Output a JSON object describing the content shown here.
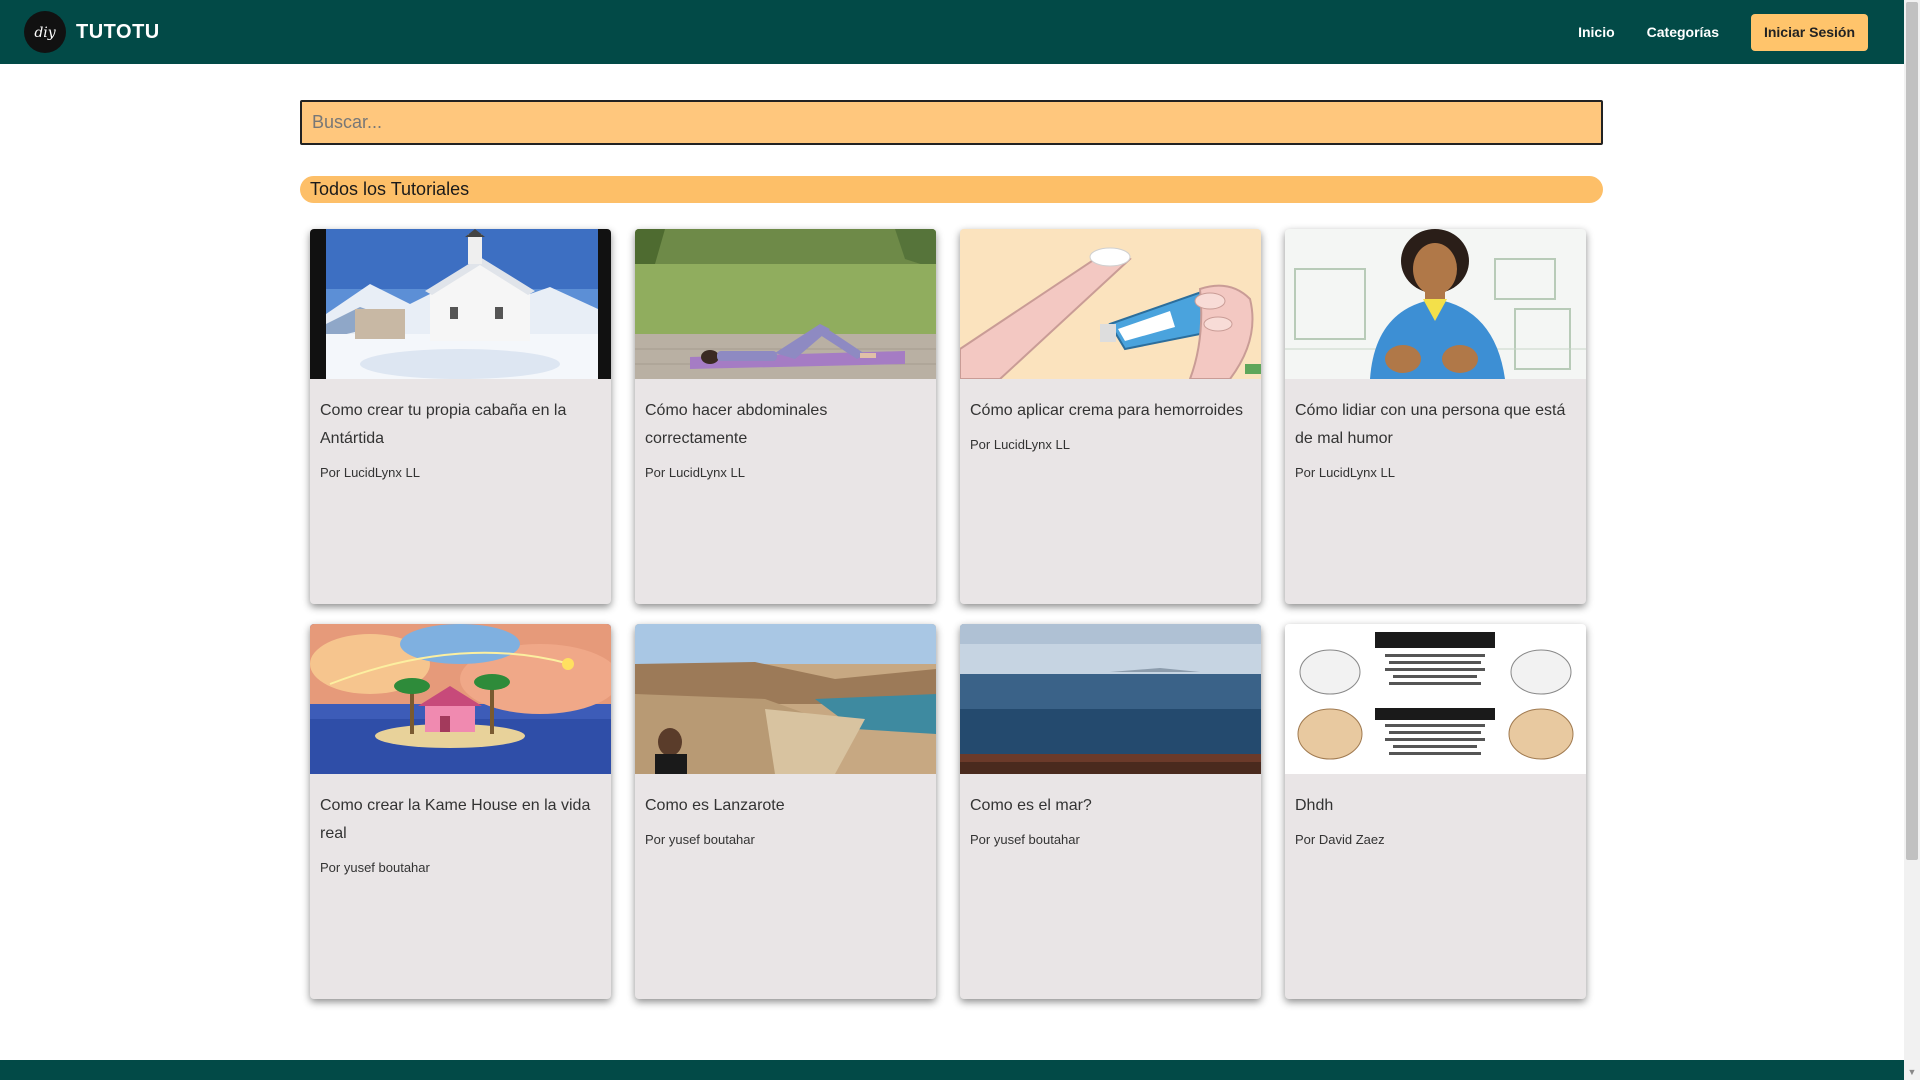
{
  "navbar": {
    "brand": "TUTOTU",
    "logo_text": "diy",
    "links": [
      "Inicio",
      "Categorías"
    ],
    "login_label": "Iniciar Sesión"
  },
  "search": {
    "placeholder": "Buscar...",
    "value": ""
  },
  "section": {
    "title": "Todos los Tutoriales"
  },
  "tutorials": [
    {
      "title": "Como crear tu propia cabaña en la Antártida",
      "author": "Por LucidLynx LL",
      "image": "snow-chapel"
    },
    {
      "title": "Cómo hacer abdominales correctamente",
      "author": "Por LucidLynx LL",
      "image": "yoga-mat-field"
    },
    {
      "title": "Cómo aplicar crema para hemorroides",
      "author": "Por LucidLynx LL",
      "image": "cream-tube-illustration"
    },
    {
      "title": "Cómo lidiar con una persona que está de mal humor",
      "author": "Por LucidLynx LL",
      "image": "woman-illustration"
    },
    {
      "title": "Como crear la Kame House en la vida real",
      "author": "Por yusef boutahar",
      "image": "island-house"
    },
    {
      "title": "Como es Lanzarote",
      "author": "Por yusef boutahar",
      "image": "lanzarote-cliffs"
    },
    {
      "title": "Como es el mar?",
      "author": "Por yusef boutahar",
      "image": "sea-view"
    },
    {
      "title": "Dhdh",
      "author": "Por David Zaez",
      "image": "meme-faces"
    }
  ],
  "colors": {
    "navbar": "#024A47",
    "accent": "#FFC46B",
    "card": "#E9E5E6"
  }
}
